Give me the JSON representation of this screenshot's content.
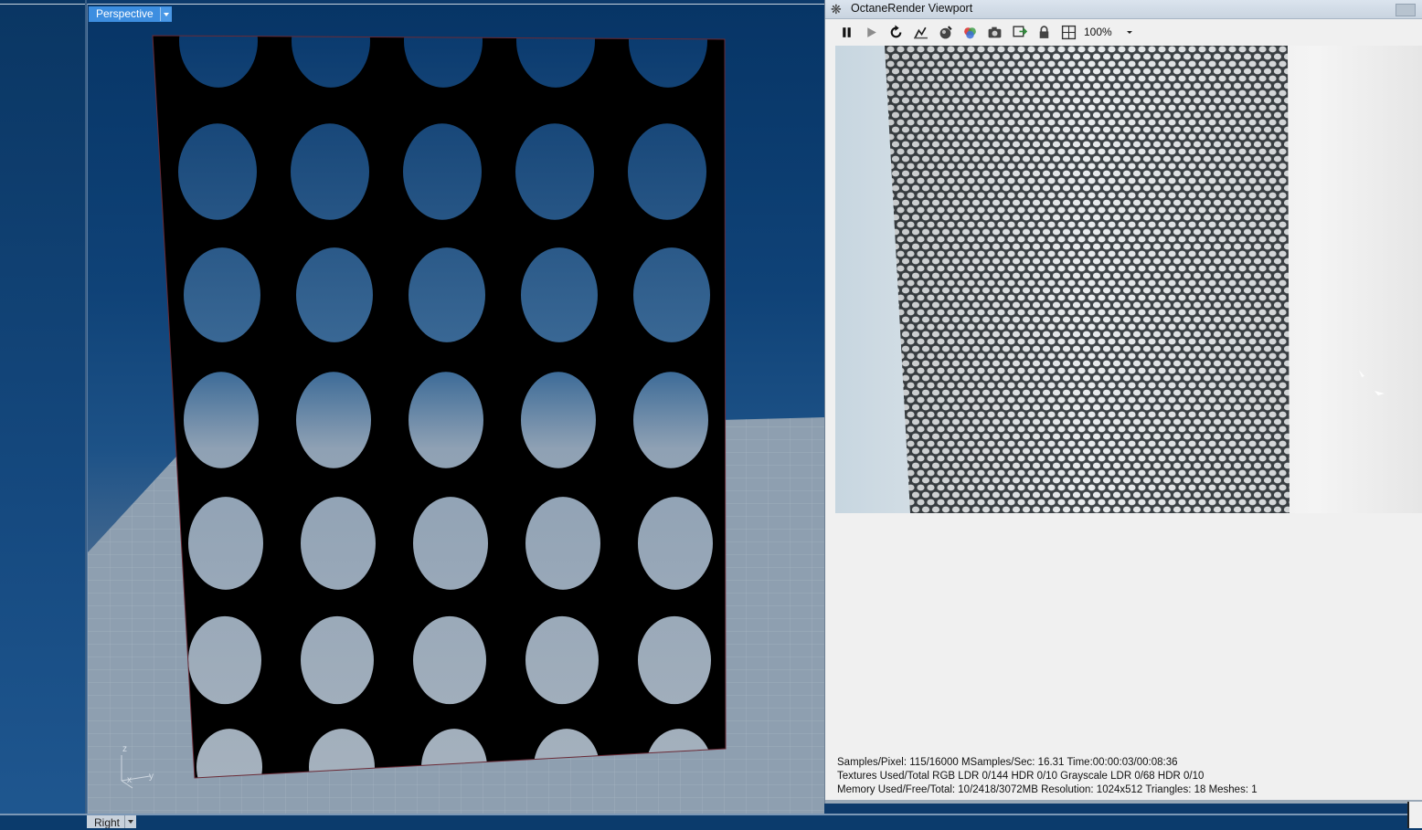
{
  "viewports": {
    "perspective_label": "Perspective",
    "right_label": "Right",
    "axis": {
      "z": "z",
      "x": "x",
      "y": "y"
    }
  },
  "octane": {
    "title": "OctaneRender Viewport",
    "toolbar": {
      "icons": [
        "pause-icon",
        "play-icon",
        "restart-icon",
        "render-region-icon",
        "material-picker-icon",
        "color-picker-icon",
        "camera-snapshot-icon",
        "export-icon",
        "lock-icon",
        "layout-icon"
      ],
      "zoom": "100%"
    },
    "stats": {
      "line1": "Samples/Pixel: 115/16000  MSamples/Sec: 16.31  Time:00:00:03/00:08:36",
      "line2": "Textures Used/Total RGB LDR 0/144  HDR 0/10  Grayscale LDR 0/68  HDR 0/10",
      "line3": "Memory Used/Free/Total: 10/2418/3072MB  Resolution: 1024x512  Triangles: 18  Meshes:  1"
    }
  },
  "colors": {
    "tab_active": "#3d8ee0",
    "panel_bg": "#f0f0f0",
    "viewport_sky": "#0f4277"
  }
}
